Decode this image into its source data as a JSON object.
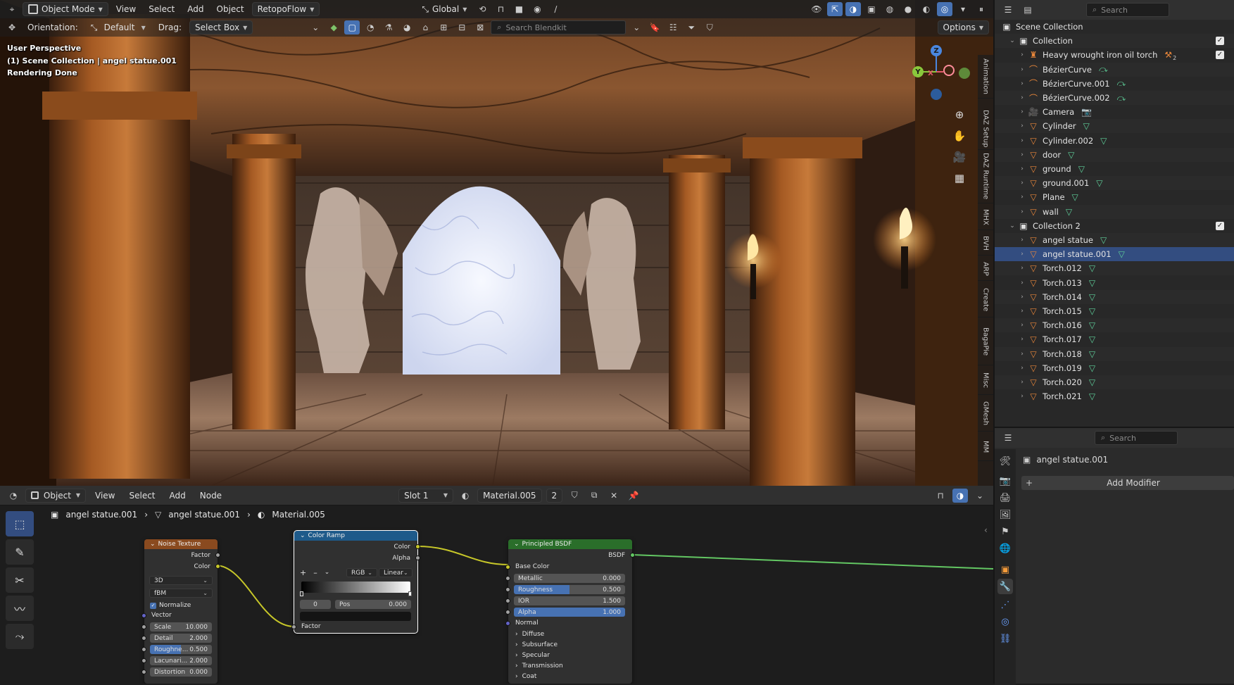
{
  "viewport": {
    "mode": "Object Mode",
    "menus": [
      "View",
      "Select",
      "Add",
      "Object"
    ],
    "retopo": "RetopoFlow",
    "transform_space": "Global",
    "orientation_label": "Orientation:",
    "orientation_value": "Default",
    "drag_label": "Drag:",
    "drag_value": "Select Box",
    "search_placeholder": "Search Blendkit",
    "options": "Options",
    "overlay": {
      "perspective": "User Perspective",
      "context": "(1) Scene Collection | angel statue.001",
      "status": "Rendering Done"
    },
    "gizmo": {
      "z": "Z",
      "y": "Y",
      "x": "X"
    },
    "side_tabs": [
      "Animation",
      "DAZ Setup",
      "DAZ Runtime",
      "MHX",
      "BVH",
      "ARP",
      "Create",
      "BagaPie",
      "Misc",
      "GMesh",
      "MM"
    ]
  },
  "node_editor": {
    "type": "Object",
    "menus": [
      "View",
      "Select",
      "Add",
      "Node"
    ],
    "slot": "Slot 1",
    "material": "Material.005",
    "users": "2",
    "breadcrumbs": [
      "angel statue.001",
      "angel statue.001",
      "Material.005"
    ],
    "noise": {
      "title": "Noise Texture",
      "out_factor": "Factor",
      "out_color": "Color",
      "dims": "3D",
      "type": "fBM",
      "normalize": "Normalize",
      "vector": "Vector",
      "scale_label": "Scale",
      "scale": "10.000",
      "detail_label": "Detail",
      "detail": "2.000",
      "rough_label": "Roughne...",
      "rough": "0.500",
      "lac_label": "Lacunari...",
      "lac": "2.000",
      "dist_label": "Distortion",
      "dist": "0.000"
    },
    "ramp": {
      "title": "Color Ramp",
      "out_color": "Color",
      "out_alpha": "Alpha",
      "plus": "+",
      "minus": "–",
      "mode": "RGB",
      "interp": "Linear",
      "index": "0",
      "pos_label": "Pos",
      "pos": "0.000",
      "in_factor": "Factor"
    },
    "bsdf": {
      "title": "Principled BSDF",
      "out": "BSDF",
      "base_color": "Base Color",
      "metallic_label": "Metallic",
      "metallic": "0.000",
      "rough_label": "Roughness",
      "rough": "0.500",
      "rough_frac": 0.5,
      "ior_label": "IOR",
      "ior": "1.500",
      "alpha_label": "Alpha",
      "alpha": "1.000",
      "normal": "Normal",
      "panels": [
        "Diffuse",
        "Subsurface",
        "Specular",
        "Transmission",
        "Coat"
      ]
    }
  },
  "outliner": {
    "search_placeholder": "Search",
    "scene": "Scene Collection",
    "collection": "Collection",
    "items": [
      {
        "name": "Heavy wrought iron oil torch",
        "icon": "armature-icon",
        "badge": "2"
      },
      {
        "name": "BézierCurve",
        "icon": "curve-icon"
      },
      {
        "name": "BézierCurve.001",
        "icon": "curve-icon"
      },
      {
        "name": "BézierCurve.002",
        "icon": "curve-icon"
      },
      {
        "name": "Camera",
        "icon": "camera-icon"
      },
      {
        "name": "Cylinder",
        "icon": "mesh-icon"
      },
      {
        "name": "Cylinder.002",
        "icon": "mesh-icon"
      },
      {
        "name": "door",
        "icon": "mesh-icon"
      },
      {
        "name": "ground",
        "icon": "mesh-icon"
      },
      {
        "name": "ground.001",
        "icon": "mesh-icon"
      },
      {
        "name": "Plane",
        "icon": "mesh-icon"
      },
      {
        "name": "wall",
        "icon": "mesh-icon"
      }
    ],
    "collection2": "Collection 2",
    "items2": [
      {
        "name": "angel statue"
      },
      {
        "name": "angel statue.001"
      },
      {
        "name": "Torch.012"
      },
      {
        "name": "Torch.013"
      },
      {
        "name": "Torch.014"
      },
      {
        "name": "Torch.015"
      },
      {
        "name": "Torch.016"
      },
      {
        "name": "Torch.017"
      },
      {
        "name": "Torch.018"
      },
      {
        "name": "Torch.019"
      },
      {
        "name": "Torch.020"
      },
      {
        "name": "Torch.021"
      }
    ]
  },
  "properties": {
    "search_placeholder": "Search",
    "object": "angel statue.001",
    "add_modifier": "Add Modifier"
  },
  "colors": {
    "accent": "#4772b3",
    "node_texture": "#8a4a1f",
    "node_converter": "#1e5a8a",
    "node_shader": "#2a6e2a",
    "socket_color": "#c7c729",
    "socket_float": "#a1a1a1",
    "socket_vector": "#6363c7",
    "socket_shader": "#63c763"
  }
}
